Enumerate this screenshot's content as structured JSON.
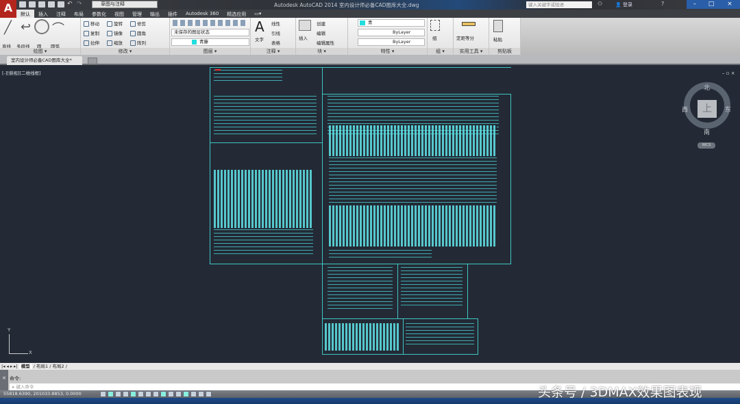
{
  "app": {
    "title": "Autodesk AutoCAD 2014    室内设计师必备CAD图库大全.dwg",
    "workspace": "草图与注释",
    "search_placeholder": "键入关键字或短语",
    "login": "登录"
  },
  "ribbon_tabs": [
    "默认",
    "插入",
    "注释",
    "布局",
    "参数化",
    "视图",
    "管理",
    "输出",
    "插件",
    "Autodesk 360",
    "精选应用",
    "▭▾"
  ],
  "panels": {
    "draw": {
      "label": "绘图 ▾",
      "items": [
        "直线",
        "多段线",
        "圆",
        "圆弧"
      ]
    },
    "modify": {
      "label": "修改 ▾",
      "items": [
        "移动",
        "旋转",
        "修剪",
        "复制",
        "镜像",
        "圆角",
        "拉伸",
        "缩放",
        "阵列"
      ]
    },
    "layers": {
      "label": "图层 ▾",
      "layer_state": "未保存的图层状态",
      "current_layer": "青藤"
    },
    "annotation": {
      "label": "注释 ▾",
      "items": [
        "文字",
        "线性",
        "引线",
        "表格"
      ]
    },
    "block": {
      "label": "块 ▾",
      "items": [
        "插入",
        "创建",
        "编辑",
        "编辑属性"
      ]
    },
    "properties": {
      "label": "特性 ▾",
      "color": "青",
      "linetype": "ByLayer",
      "lineweight": "ByLayer"
    },
    "groups": {
      "label": "组 ▾",
      "items": [
        "组"
      ]
    },
    "utilities": {
      "label": "实用工具 ▾",
      "items": [
        "定距等分"
      ]
    },
    "clipboard": {
      "label": "剪贴板",
      "items": [
        "粘贴"
      ]
    }
  },
  "doc_tab": "室内设计师必备CAD图库大全*",
  "viewport_label": "[-][俯视][二维线框]",
  "viewcube": {
    "north": "北",
    "south": "南",
    "east": "东",
    "west": "西",
    "top": "上",
    "wcs": "WCS"
  },
  "ucs": {
    "y": "Y",
    "x": "X"
  },
  "layout_tabs": [
    "模型",
    "布局1",
    "布局2"
  ],
  "command": {
    "label": "命令:",
    "placeholder": "键入命令"
  },
  "status": {
    "coords": "55818.6390, 201033.8853, 0.0000"
  },
  "watermark": "头条号 / 3DMAX效果图表现",
  "colors": {
    "accent": "#3fc6c6",
    "background": "#232a35"
  }
}
